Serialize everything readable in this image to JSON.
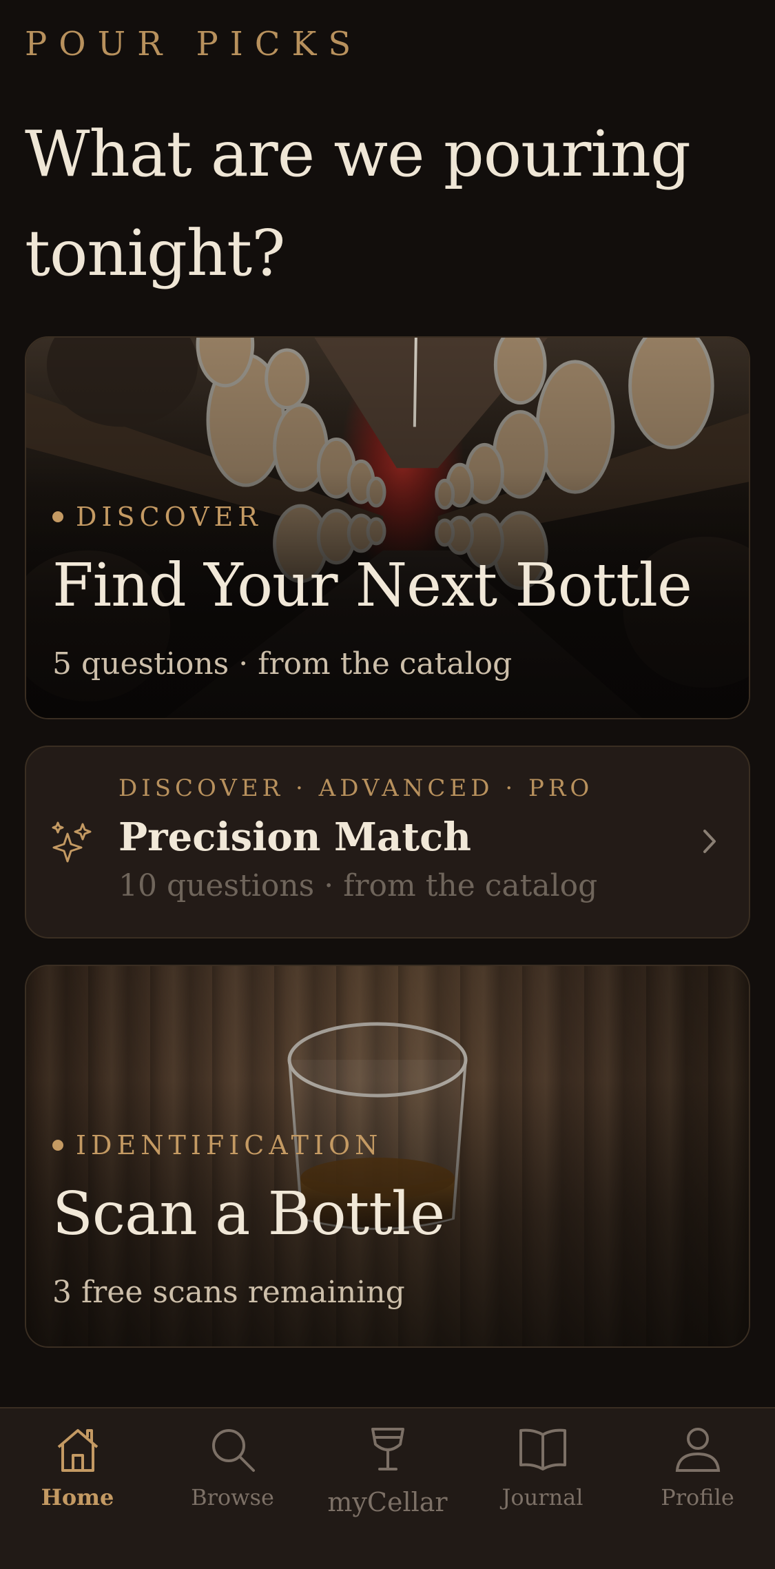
{
  "app": {
    "brand": "POUR PICKS",
    "headline": "What are we pouring tonight?"
  },
  "cards": {
    "discover": {
      "eyebrow": "DISCOVER",
      "title": "Find Your Next Bottle",
      "subtitle": "5 questions · from the catalog"
    },
    "precision": {
      "eyebrow": "DISCOVER · ADVANCED · PRO",
      "title": "Precision Match",
      "subtitle": "10 questions · from the catalog",
      "icon": "sparkles-icon"
    },
    "scan": {
      "eyebrow": "IDENTIFICATION",
      "title": "Scan a Bottle",
      "subtitle": "3 free scans remaining"
    }
  },
  "nav": {
    "items": [
      {
        "label": "Home",
        "icon": "home-icon",
        "active": true
      },
      {
        "label": "Browse",
        "icon": "search-icon",
        "active": false
      },
      {
        "label": "myCellar",
        "icon": "glass-icon",
        "active": false
      },
      {
        "label": "Journal",
        "icon": "book-icon",
        "active": false
      },
      {
        "label": "Profile",
        "icon": "user-icon",
        "active": false
      }
    ]
  },
  "colors": {
    "background": "#120e0c",
    "accent": "#c49a63",
    "card": "#231b17",
    "text": "#efe6d6",
    "muted": "#7c7066"
  }
}
